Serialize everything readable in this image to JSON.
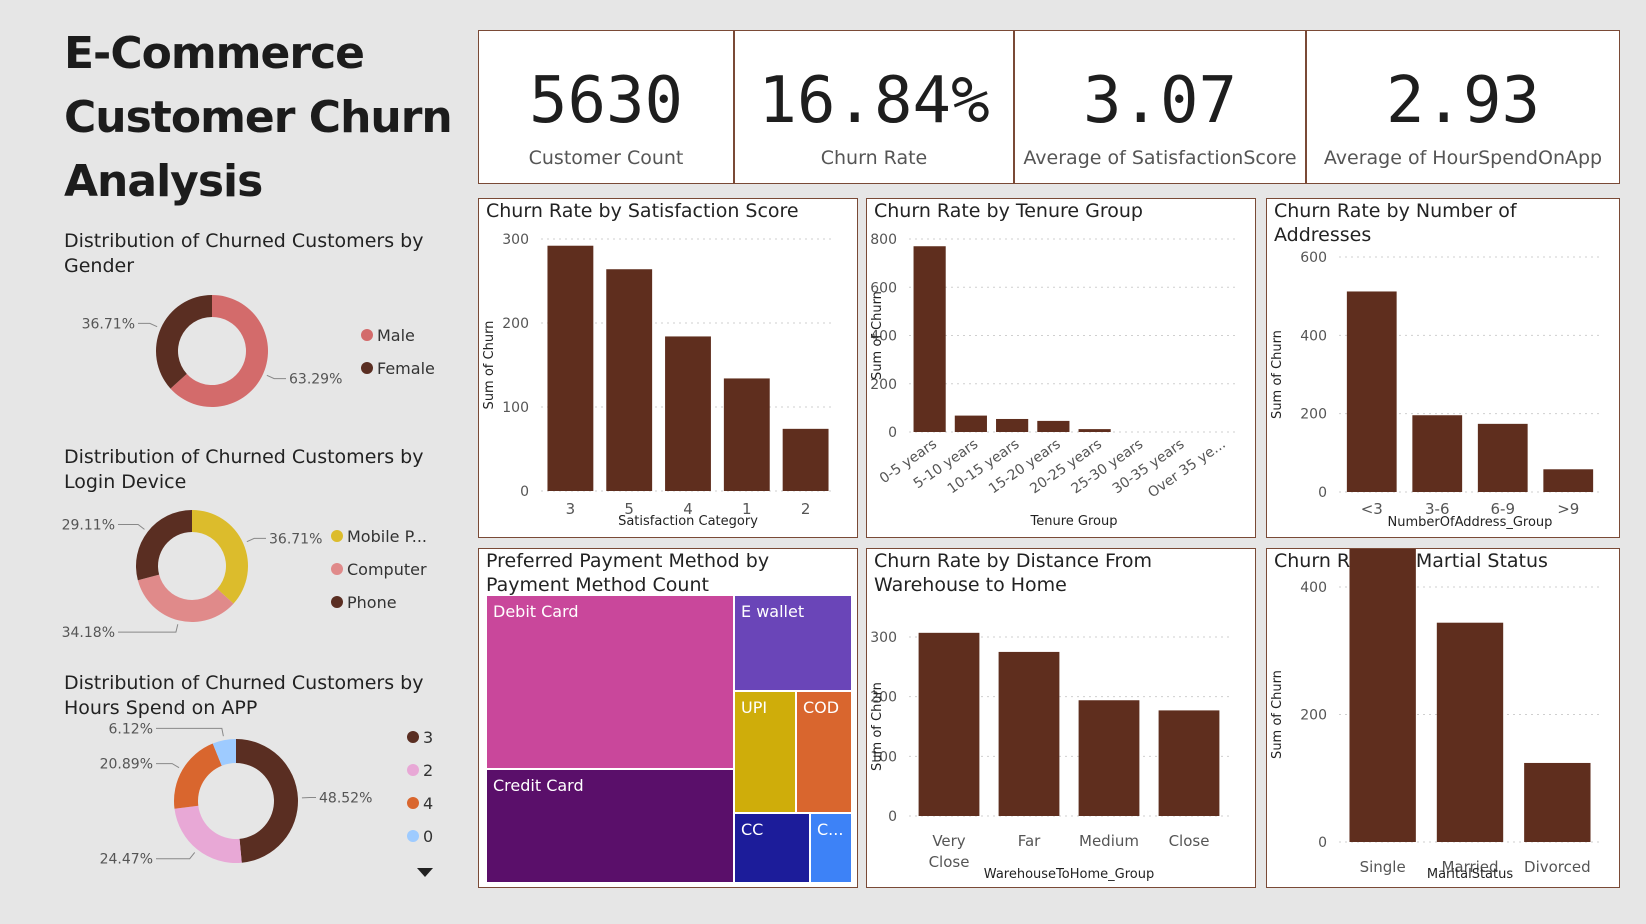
{
  "title": [
    "E-Commerce",
    "Customer Churn",
    "Analysis"
  ],
  "kpis": [
    {
      "value": "5630",
      "label": "Customer Count"
    },
    {
      "value": "16.84%",
      "label": "Churn Rate"
    },
    {
      "value": "3.07",
      "label": "Average of SatisfactionScore"
    },
    {
      "value": "2.93",
      "label": "Average of HourSpendOnApp"
    }
  ],
  "colors": {
    "bar": "#5f2e1e",
    "card_border": "#7a4a36"
  },
  "chart_data": [
    {
      "id": "gender",
      "type": "pie",
      "title": "Distribution of Churned Customers by Gender",
      "labels": [
        "Male",
        "Female"
      ],
      "values": [
        63.29,
        36.71
      ],
      "value_labels": [
        "63.29%",
        "36.71%"
      ],
      "colors": [
        "#d36b6b",
        "#5a2e22"
      ]
    },
    {
      "id": "device",
      "type": "pie",
      "title": "Distribution of Churned Customers by Login Device",
      "labels": [
        "Mobile P...",
        "Computer",
        "Phone"
      ],
      "values": [
        36.71,
        34.18,
        29.11
      ],
      "value_labels": [
        "36.71%",
        "34.18%",
        "29.11%"
      ],
      "colors": [
        "#dcbc2c",
        "#e08a8a",
        "#5a2e22"
      ]
    },
    {
      "id": "hours",
      "type": "pie",
      "title": "Distribution of Churned Customers by Hours Spend on APP",
      "labels": [
        "3",
        "2",
        "4",
        "0"
      ],
      "values": [
        48.52,
        24.47,
        20.89,
        6.12
      ],
      "value_labels": [
        "48.52%",
        "24.47%",
        "20.89%",
        "6.12%"
      ],
      "colors": [
        "#5a2e22",
        "#e8a8d6",
        "#d9662e",
        "#9ecbff"
      ]
    },
    {
      "id": "satisfaction",
      "type": "bar",
      "title": "Churn Rate by Satisfaction Score",
      "categories": [
        "3",
        "5",
        "4",
        "1",
        "2"
      ],
      "values": [
        292,
        264,
        184,
        134,
        74
      ],
      "xlabel": "Satisfaction Category",
      "ylabel": "Sum of Churn",
      "ylim": [
        0,
        300
      ],
      "yticks": [
        0,
        100,
        200,
        300
      ]
    },
    {
      "id": "tenure",
      "type": "bar",
      "title": "Churn Rate by Tenure Group",
      "categories": [
        "0-5 years",
        "5-10 years",
        "10-15 years",
        "15-20 years",
        "20-25 years",
        "25-30 years",
        "30-35 years",
        "Over 35 ye..."
      ],
      "values": [
        770,
        68,
        54,
        46,
        12,
        0,
        0,
        0
      ],
      "xlabel": "Tenure Group",
      "ylabel": "Sum of Churn",
      "ylim": [
        0,
        800
      ],
      "yticks": [
        0,
        200,
        400,
        600,
        800
      ]
    },
    {
      "id": "addresses",
      "type": "bar",
      "title": "Churn Rate by Number of Addresses",
      "categories": [
        "<3",
        "3-6",
        "6-9",
        ">9"
      ],
      "values": [
        512,
        196,
        174,
        58
      ],
      "xlabel": "NumberOfAddress_Group",
      "ylabel": "Sum of Churn",
      "ylim": [
        0,
        600
      ],
      "yticks": [
        0,
        200,
        400,
        600
      ]
    },
    {
      "id": "payment",
      "type": "treemap",
      "title": "Preferred Payment Method by Payment Method Count",
      "labels": [
        "Debit Card",
        "Credit Card",
        "E wallet",
        "UPI",
        "COD",
        "CC",
        "C..."
      ],
      "colors": [
        "#c9479b",
        "#5a0f6a",
        "#6a45b8",
        "#cfad0a",
        "#d9662e",
        "#1c1c9a",
        "#3d82f7"
      ]
    },
    {
      "id": "distance",
      "type": "bar",
      "title": "Churn Rate by Distance From Warehouse to Home",
      "categories": [
        "Very Close",
        "Far",
        "Medium",
        "Close"
      ],
      "values": [
        307,
        275,
        194,
        177
      ],
      "xlabel": "WarehouseToHome_Group",
      "ylabel": "Sum of Churn",
      "ylim": [
        0,
        300
      ],
      "yticks": [
        0,
        100,
        200,
        300
      ]
    },
    {
      "id": "marital",
      "type": "bar",
      "title": "Churn Rate by Martial Status",
      "categories": [
        "Single",
        "Married",
        "Divorced"
      ],
      "values": [
        480,
        344,
        124
      ],
      "xlabel": "MaritalStatus",
      "ylabel": "Sum of Churn",
      "ylim": [
        0,
        400
      ],
      "yticks": [
        0,
        200,
        400
      ]
    }
  ]
}
